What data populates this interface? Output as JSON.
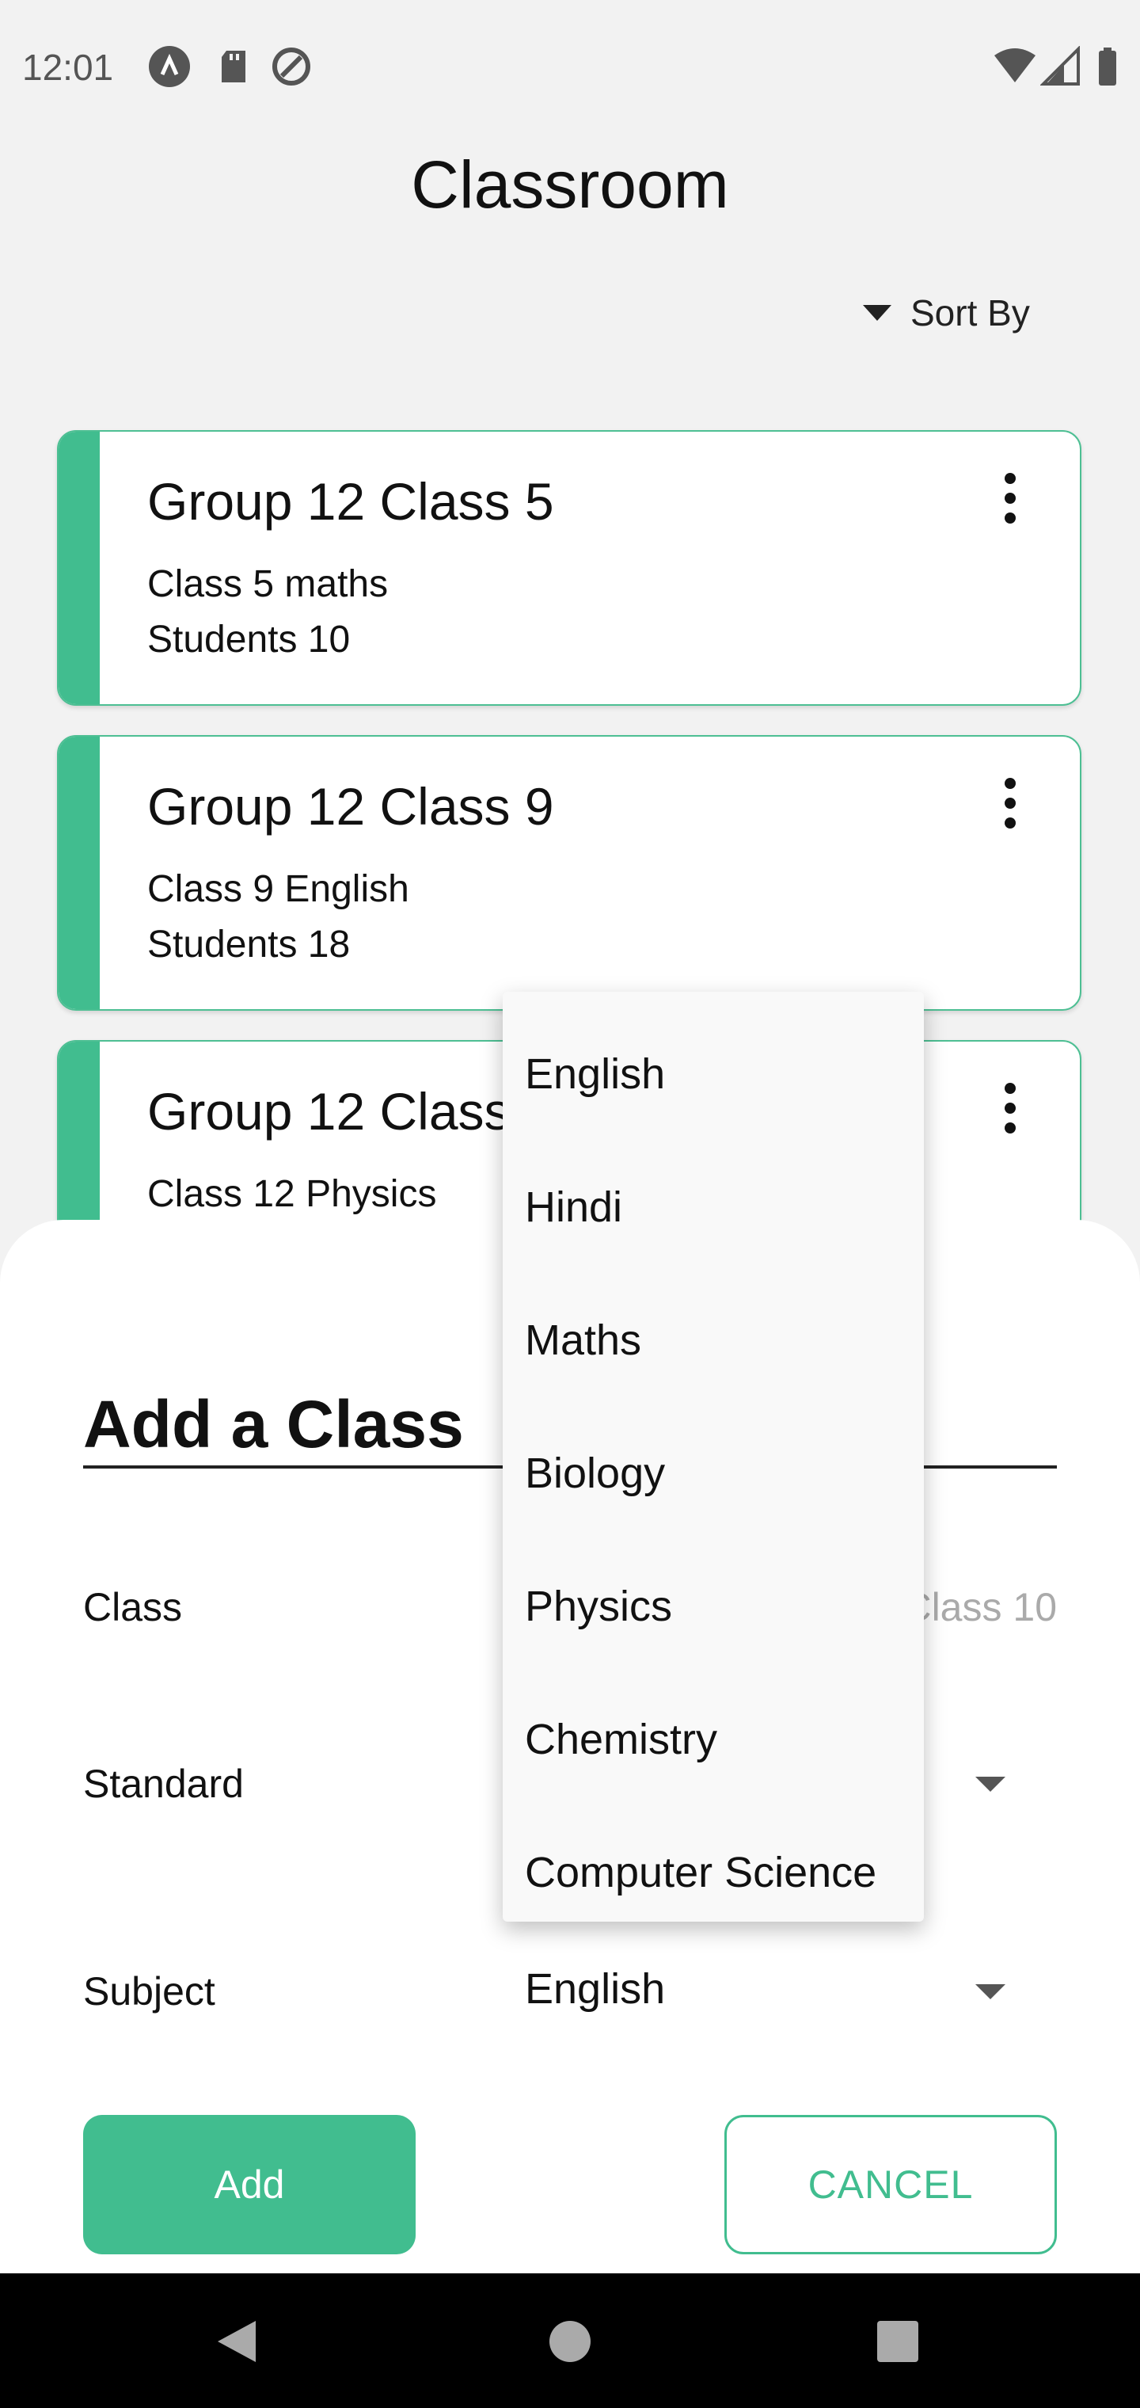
{
  "status_bar": {
    "time": "12:01"
  },
  "header": {
    "title": "Classroom",
    "sort_label": "Sort By"
  },
  "cards": [
    {
      "title": "Group 12 Class 5",
      "subtitle": "Class 5 maths",
      "students": "Students 10"
    },
    {
      "title": "Group 12 Class 9",
      "subtitle": "Class 9 English",
      "students": "Students 18"
    },
    {
      "title": "Group 12 Class",
      "subtitle": "Class 12 Physics",
      "students": ""
    }
  ],
  "sheet": {
    "title": "Add a Class",
    "class_label": "Class",
    "class_placeholder": "Class 10",
    "standard_label": "Standard",
    "subject_label": "Subject",
    "subject_value": "English",
    "add_label": "Add",
    "cancel_label": "CANCEL"
  },
  "dropdown": {
    "options": [
      "English",
      "Hindi",
      "Maths",
      "Biology",
      "Physics",
      "Chemistry",
      "Computer Science"
    ]
  },
  "colors": {
    "accent": "#41bd8f",
    "background": "#f2f2f2"
  }
}
